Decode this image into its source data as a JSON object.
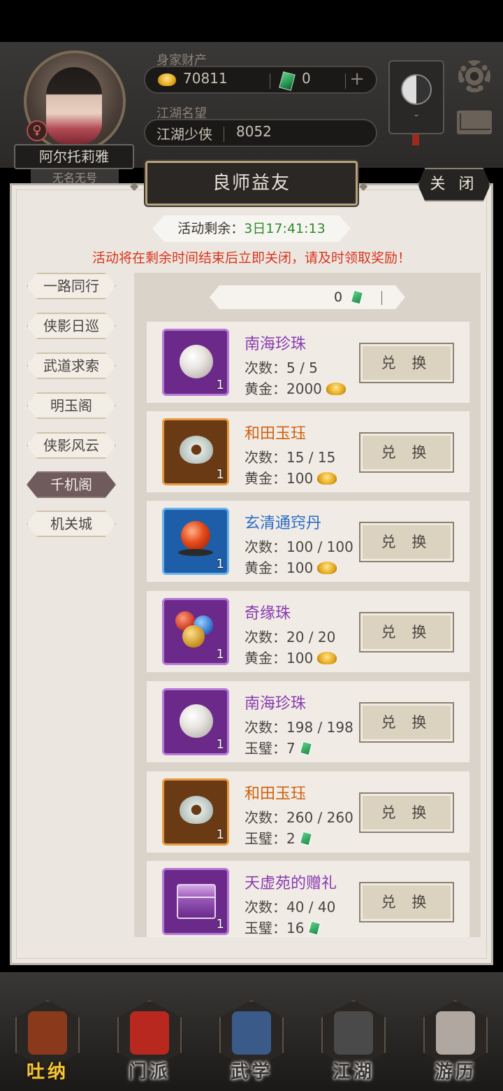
{
  "header": {
    "player_name": "阿尔托莉雅",
    "player_title": "无名无号",
    "wealth_label": "身家财产",
    "gold": "70811",
    "jade": "0",
    "plus": "+",
    "fame_label": "江湖名望",
    "fame_title": "江湖少侠",
    "fame_value": "8052",
    "taiji_minus": "-"
  },
  "modal": {
    "title": "良师益友",
    "close_label": "关 闭",
    "countdown_label": "活动剩余：",
    "countdown_value": "3日17:41:13",
    "notice": "活动将在剩余时间结束后立即关闭，请及时领取奖励！"
  },
  "tabs": [
    {
      "label": "一路同行"
    },
    {
      "label": "侠影日巡"
    },
    {
      "label": "武道求索"
    },
    {
      "label": "明玉阁"
    },
    {
      "label": "侠影风云"
    },
    {
      "label": "千机阁",
      "active": true
    },
    {
      "label": "机关城"
    }
  ],
  "balance": {
    "jade": "0",
    "gold": "70811"
  },
  "exchange_label": "兑 换",
  "items": [
    {
      "name": "南海珍珠",
      "rarity": "purple",
      "icon": "pearl-icon",
      "qty": "1",
      "count": "次数：5 / 5",
      "cost": "黄金：2000",
      "currency": "gold"
    },
    {
      "name": "和田玉珏",
      "rarity": "orange",
      "icon": "jade-pendant-icon",
      "qty": "1",
      "count": "次数：15 / 15",
      "cost": "黄金：100",
      "currency": "gold"
    },
    {
      "name": "玄清通窍丹",
      "rarity": "blue",
      "icon": "red-pill-icon",
      "qty": "1",
      "count": "次数：100 / 100",
      "cost": "黄金：100",
      "currency": "gold"
    },
    {
      "name": "奇缘珠",
      "rarity": "purple",
      "icon": "orbs-icon",
      "qty": "1",
      "count": "次数：20 / 20",
      "cost": "黄金：100",
      "currency": "gold"
    },
    {
      "name": "南海珍珠",
      "rarity": "purple",
      "icon": "pearl-icon",
      "qty": "1",
      "count": "次数：198 / 198",
      "cost": "玉璧：7",
      "currency": "jade"
    },
    {
      "name": "和田玉珏",
      "rarity": "orange",
      "icon": "jade-pendant-icon",
      "qty": "1",
      "count": "次数：260 / 260",
      "cost": "玉璧：2",
      "currency": "jade"
    },
    {
      "name": "天虚苑的赠礼",
      "rarity": "purple",
      "icon": "gift-chest-icon",
      "qty": "1",
      "count": "次数：40 / 40",
      "cost": "玉璧：16",
      "currency": "jade"
    }
  ],
  "bottom_nav": [
    {
      "label": "吐纳",
      "active": true,
      "color": "#8a3a1a"
    },
    {
      "label": "门派",
      "color": "#b8281e"
    },
    {
      "label": "武学",
      "color": "#3a5a8a"
    },
    {
      "label": "江湖",
      "color": "#4a4a4a"
    },
    {
      "label": "游历",
      "color": "#b0a8a0"
    }
  ]
}
